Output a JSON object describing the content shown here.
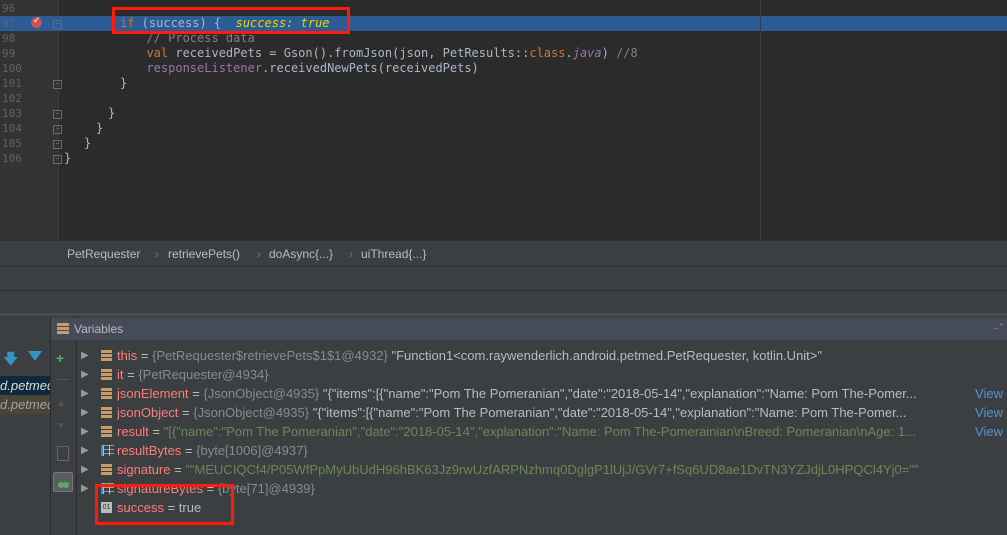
{
  "editor": {
    "lines": [
      {
        "n": "96",
        "parts": []
      },
      {
        "n": "97",
        "parts": [
          {
            "c": "kw",
            "t": "if"
          },
          {
            "c": "",
            "t": " (success) {  "
          },
          {
            "c": "inl",
            "t": "success: true"
          }
        ],
        "selected": true,
        "breakpoint": true
      },
      {
        "n": "98",
        "parts": [
          {
            "c": "cmt",
            "t": "  // Process data"
          }
        ]
      },
      {
        "n": "99",
        "parts": [
          {
            "c": "kw",
            "t": "  val"
          },
          {
            "c": "",
            "t": " receivedPets = Gson().fromJson(json, PetResults::"
          },
          {
            "c": "kw",
            "t": "class"
          },
          {
            "c": "",
            "t": "."
          },
          {
            "c": "fld it",
            "t": "java"
          },
          {
            "c": "",
            "t": ") "
          },
          {
            "c": "cmt",
            "t": "//8"
          }
        ]
      },
      {
        "n": "100",
        "parts": [
          {
            "c": "fld",
            "t": "  responseListener"
          },
          {
            "c": "",
            "t": ".receivedNewPets(receivedPets)"
          }
        ]
      },
      {
        "n": "101",
        "parts": [
          {
            "c": "",
            "t": "}"
          }
        ]
      },
      {
        "n": "102",
        "parts": []
      },
      {
        "n": "103",
        "parts": [
          {
            "c": "",
            "t": "}"
          }
        ]
      },
      {
        "n": "104",
        "parts": [
          {
            "c": "",
            "t": "}"
          }
        ]
      },
      {
        "n": "105",
        "parts": [
          {
            "c": "",
            "t": "}"
          }
        ]
      },
      {
        "n": "106",
        "parts": [
          {
            "c": "",
            "t": "}"
          }
        ]
      }
    ]
  },
  "breadcrumbs": [
    "PetRequester",
    "retrievePets()",
    "doAsync{...}",
    "uiThread{...}"
  ],
  "frames": [
    "d.petmed",
    "d.petmed"
  ],
  "variables_panel": {
    "title": "Variables",
    "pin": "→\""
  },
  "variables": [
    {
      "name": "this",
      "type": "{PetRequester$retrievePets$1$1@4932}",
      "value": " \"Function1<com.raywenderlich.android.petmed.PetRequester, kotlin.Unit>\"",
      "vclass": "strw",
      "icon": "field",
      "expand": true
    },
    {
      "name": "it",
      "type": "{PetRequester@4934}",
      "value": "",
      "vclass": "strw",
      "icon": "field",
      "expand": true
    },
    {
      "name": "jsonElement",
      "type": "{JsonObject@4935}",
      "value": " \"{\"items\":[{\"name\":\"Pom The Pomeranian\",\"date\":\"2018-05-14\",\"explanation\":\"Name: Pom The-Pomer...",
      "vclass": "strw",
      "icon": "field",
      "expand": true,
      "view": "View"
    },
    {
      "name": "jsonObject",
      "type": "{JsonObject@4935}",
      "value": " \"{\"items\":[{\"name\":\"Pom The Pomeranian\",\"date\":\"2018-05-14\",\"explanation\":\"Name: Pom The-Pomer...",
      "vclass": "strw",
      "icon": "field",
      "expand": true,
      "view": "View"
    },
    {
      "name": "result",
      "type": "",
      "value": "\"[{\"name\":\"Pom The Pomeranian\",\"date\":\"2018-05-14\",\"explanation\":\"Name: Pom The-Pomerainian\\nBreed: Pomeranian\\nAge: 1...",
      "vclass": "str",
      "icon": "field",
      "expand": true,
      "view": "View"
    },
    {
      "name": "resultBytes",
      "type": "{byte[1006]@4937}",
      "value": "",
      "vclass": "strw",
      "icon": "array",
      "expand": true
    },
    {
      "name": "signature",
      "type": "",
      "value": "\"\"MEUCIQCf4/P05WfPpMyUbUdH96hBK63Jz9rwUzfARPNzhmq0DglgP1lUjJ/GVr7+fSq6UD8ae1DvTN3YZJdjL0HPQCl4Yj0=\"\"",
      "vclass": "str",
      "icon": "field",
      "expand": true
    },
    {
      "name": "signatureBytes",
      "type": "{byte[71]@4939}",
      "value": "",
      "vclass": "strw",
      "icon": "array",
      "expand": true
    },
    {
      "name": "success",
      "type": "",
      "value": "true",
      "vclass": "strw",
      "icon": "boolean",
      "expand": false
    }
  ],
  "colors": {
    "highlight_box": "#ff1a0a",
    "selection": "#2d5b95"
  }
}
